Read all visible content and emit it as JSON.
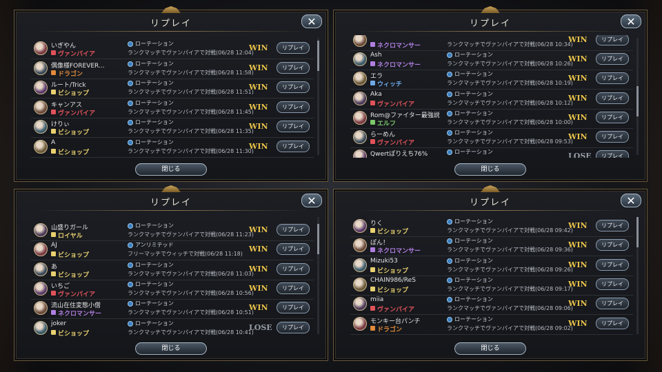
{
  "panels": [
    {
      "title": "リプレイ",
      "close_label": "閉じる",
      "rows": [
        {
          "name": "いぎやん",
          "class": "ヴァンパイア",
          "format": "ローテーション",
          "desc": "ランクマッチでヴァンパイアで対戦(06/28 12:04)",
          "result": "WIN",
          "button": "リプレイ"
        },
        {
          "name": "偶像様FOREVER...",
          "class": "ドラゴン",
          "format": "ローテーション",
          "desc": "ランクマッチでヴァンパイアで対戦(06/28 11:58)",
          "result": "WIN",
          "button": "リプレイ"
        },
        {
          "name": "ルート/Trick",
          "class": "ビショップ",
          "format": "ローテーション",
          "desc": "ランクマッチでヴァンパイアで対戦(06/28 11:51)",
          "result": "WIN",
          "button": "リプレイ"
        },
        {
          "name": "キャンアス",
          "class": "ヴァンパイア",
          "format": "ローテーション",
          "desc": "ランクマッチでヴァンパイアで対戦(06/28 11:45)",
          "result": "WIN",
          "button": "リプレイ"
        },
        {
          "name": "けりぃ",
          "class": "ビショップ",
          "format": "ローテーション",
          "desc": "ランクマッチでヴァンパイアで対戦(06/28 11:35)",
          "result": "WIN",
          "button": "リプレイ"
        },
        {
          "name": "A",
          "class": "ビショップ",
          "format": "ローテーション",
          "desc": "ランクマッチでヴァンパイアで対戦(06/28 11:30)",
          "result": "WIN",
          "button": "リプレイ"
        }
      ]
    },
    {
      "title": "リプレイ",
      "close_label": "閉じる",
      "rows": [
        {
          "name": "",
          "class": "ネクロマンサー",
          "format": "",
          "desc": "ランクマッチでヴァンパイアで対戦(06/28 10:34)",
          "result": "WIN",
          "button": "リプレイ"
        },
        {
          "name": "Ash",
          "class": "ネクロマンサー",
          "format": "ローテーション",
          "desc": "ランクマッチでヴァンパイアで対戦(06/28 10:26)",
          "result": "WIN",
          "button": "リプレイ"
        },
        {
          "name": "エラ",
          "class": "ウィッチ",
          "format": "ローテーション",
          "desc": "ランクマッチでヴァンパイアで対戦(06/28 10:19)",
          "result": "WIN",
          "button": "リプレイ"
        },
        {
          "name": "Aka",
          "class": "ヴァンパイア",
          "format": "ローテーション",
          "desc": "ランクマッチでヴァンパイアで対戦(06/28 10:12)",
          "result": "WIN",
          "button": "リプレイ"
        },
        {
          "name": "Rom@ファイター最強説",
          "class": "エルフ",
          "format": "ローテーション",
          "desc": "ランクマッチでヴァンパイアで対戦(06/28 10:00)",
          "result": "WIN",
          "button": "リプレイ"
        },
        {
          "name": "らーめん",
          "class": "ヴァンパイア",
          "format": "ローテーション",
          "desc": "ランクマッチでヴァンパイアで対戦(06/28 09:53)",
          "result": "WIN",
          "button": "リプレイ"
        },
        {
          "name": "Qwertぽりえち76%",
          "class": "",
          "format": "ローテーション",
          "desc": "",
          "result": "LOSE",
          "button": "リプレイ"
        }
      ]
    },
    {
      "title": "リプレイ",
      "close_label": "閉じる",
      "rows": [
        {
          "name": "山盛りガール",
          "class": "ロイヤル",
          "format": "ローテーション",
          "desc": "ランクマッチでヴァンパイアで対戦(06/28 11:23)",
          "result": "WIN",
          "button": "リプレイ"
        },
        {
          "name": "AJ",
          "class": "ビショップ",
          "format": "アンリミテッド",
          "desc": "フリーマッチでウィッチで対戦(06/28 11:18)",
          "result": "WIN",
          "button": "リプレイ"
        },
        {
          "name": "あ",
          "class": "ビショップ",
          "format": "ローテーション",
          "desc": "ランクマッチでヴァンパイアで対戦(06/28 11:03)",
          "result": "WIN",
          "button": "リプレイ"
        },
        {
          "name": "いちご",
          "class": "ヴァンパイア",
          "format": "ローテーション",
          "desc": "ランクマッチでヴァンパイアで対戦(06/28 10:56)",
          "result": "WIN",
          "button": "リプレイ"
        },
        {
          "name": "流山在住変態小僧",
          "class": "ネクロマンサー",
          "format": "ローテーション",
          "desc": "ランクマッチでヴァンパイアで対戦(06/28 10:51)",
          "result": "WIN",
          "button": "リプレイ"
        },
        {
          "name": "joker",
          "class": "ビショップ",
          "format": "ローテーション",
          "desc": "ランクマッチでヴァンパイアで対戦(06/28 10:41)",
          "result": "LOSE",
          "button": "リプレイ"
        }
      ]
    },
    {
      "title": "リプレイ",
      "close_label": "閉じる",
      "rows": [
        {
          "name": "りく",
          "class": "ビショップ",
          "format": "ローテーション",
          "desc": "ランクマッチでヴァンパイアで対戦(06/28 09:42)",
          "result": "WIN",
          "button": "リプレイ"
        },
        {
          "name": "ぽん！",
          "class": "ネクロマンサー",
          "format": "ローテーション",
          "desc": "ランクマッチでヴァンパイアで対戦(06/28 09:36)",
          "result": "WIN",
          "button": "リプレイ"
        },
        {
          "name": "Mizuki53",
          "class": "ビショップ",
          "format": "ローテーション",
          "desc": "ランクマッチでヴァンパイアで対戦(06/28 09:26)",
          "result": "WIN",
          "button": "リプレイ"
        },
        {
          "name": "CHAIN986/ReS",
          "class": "ビショップ",
          "format": "ローテーション",
          "desc": "ランクマッチでヴァンパイアで対戦(06/28 09:17)",
          "result": "WIN",
          "button": "リプレイ"
        },
        {
          "name": "miia",
          "class": "ヴァンパイア",
          "format": "ローテーション",
          "desc": "ランクマッチでヴァンパイアで対戦(06/28 09:06)",
          "result": "WIN",
          "button": "リプレイ"
        },
        {
          "name": "モンキー台パンチ",
          "class": "ドラゴン",
          "format": "ローテーション",
          "desc": "ランクマッチでヴァンパイアで対戦(06/28 09:02)",
          "result": "WIN",
          "button": "リプレイ"
        }
      ]
    }
  ],
  "class_colors": {
    "ヴァンパイア": "#e0525a",
    "ドラゴン": "#e08a3a",
    "ビショップ": "#e8d070",
    "ネクロマンサー": "#b07ee0",
    "ウィッチ": "#6fa8e6",
    "エルフ": "#7cc86a",
    "ロイヤル": "#e8d070"
  },
  "icons": {
    "close": "close-icon",
    "format": "rotation-format-icon"
  }
}
